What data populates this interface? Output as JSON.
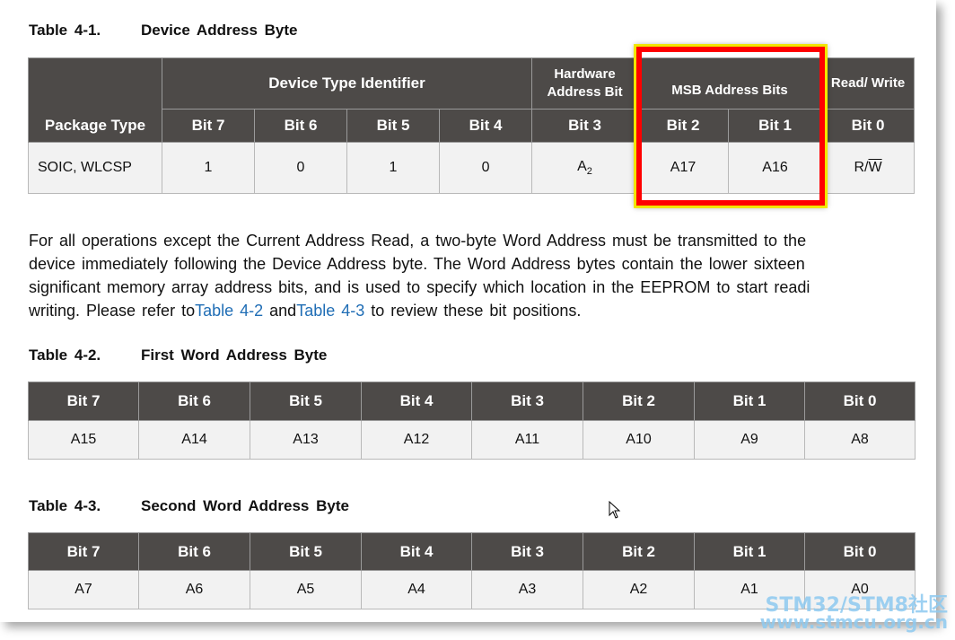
{
  "table1": {
    "number": "Table 4-1.",
    "title": "Device Address Byte",
    "group_headers": {
      "device_type": "Device Type Identifier",
      "hardware": "Hardware Address Bit",
      "msb": "MSB Address Bits",
      "rw": "Read/ Write"
    },
    "package_header": "Package Type",
    "bit_headers": [
      "Bit 7",
      "Bit 6",
      "Bit 5",
      "Bit 4",
      "Bit 3",
      "Bit 2",
      "Bit 1",
      "Bit 0"
    ],
    "row": {
      "package": "SOIC, WLCSP",
      "cells": [
        "1",
        "0",
        "1",
        "0"
      ],
      "a2_base": "A",
      "a2_sub": "2",
      "a17": "A17",
      "a16": "A16",
      "rw_r": "R/",
      "rw_w": "W"
    }
  },
  "paragraph": {
    "line1": "For all operations except the Current Address Read, a two-byte Word Address must be transmitted to the",
    "line2": "device immediately following the Device Address byte. The Word Address bytes contain the lower sixteen",
    "line3": "significant memory array address bits, and is used to specify which location in the EEPROM to start readi",
    "line4_a": "writing. Please refer to",
    "link1": "Table 4-2",
    "line4_b": "and",
    "link2": "Table 4-3",
    "line4_c": "to review these bit positions."
  },
  "table2": {
    "number": "Table 4-2.",
    "title": "First Word Address Byte",
    "headers": [
      "Bit 7",
      "Bit 6",
      "Bit 5",
      "Bit 4",
      "Bit 3",
      "Bit 2",
      "Bit 1",
      "Bit 0"
    ],
    "values": [
      "A15",
      "A14",
      "A13",
      "A12",
      "A11",
      "A10",
      "A9",
      "A8"
    ]
  },
  "table3": {
    "number": "Table 4-3.",
    "title": "Second Word Address Byte",
    "headers": [
      "Bit 7",
      "Bit 6",
      "Bit 5",
      "Bit 4",
      "Bit 3",
      "Bit 2",
      "Bit 1",
      "Bit 0"
    ],
    "values": [
      "A7",
      "A6",
      "A5",
      "A4",
      "A3",
      "A2",
      "A1",
      "A0"
    ]
  },
  "watermark": {
    "line1": "STM32/STM8社区",
    "line2": "www.stmcu.org.cn"
  },
  "colors": {
    "header_bg": "#4d4a48",
    "cell_bg": "#f2f2f2",
    "highlight_border": "#ff0000",
    "highlight_outline": "#f1e600",
    "link": "#1f6db5"
  }
}
